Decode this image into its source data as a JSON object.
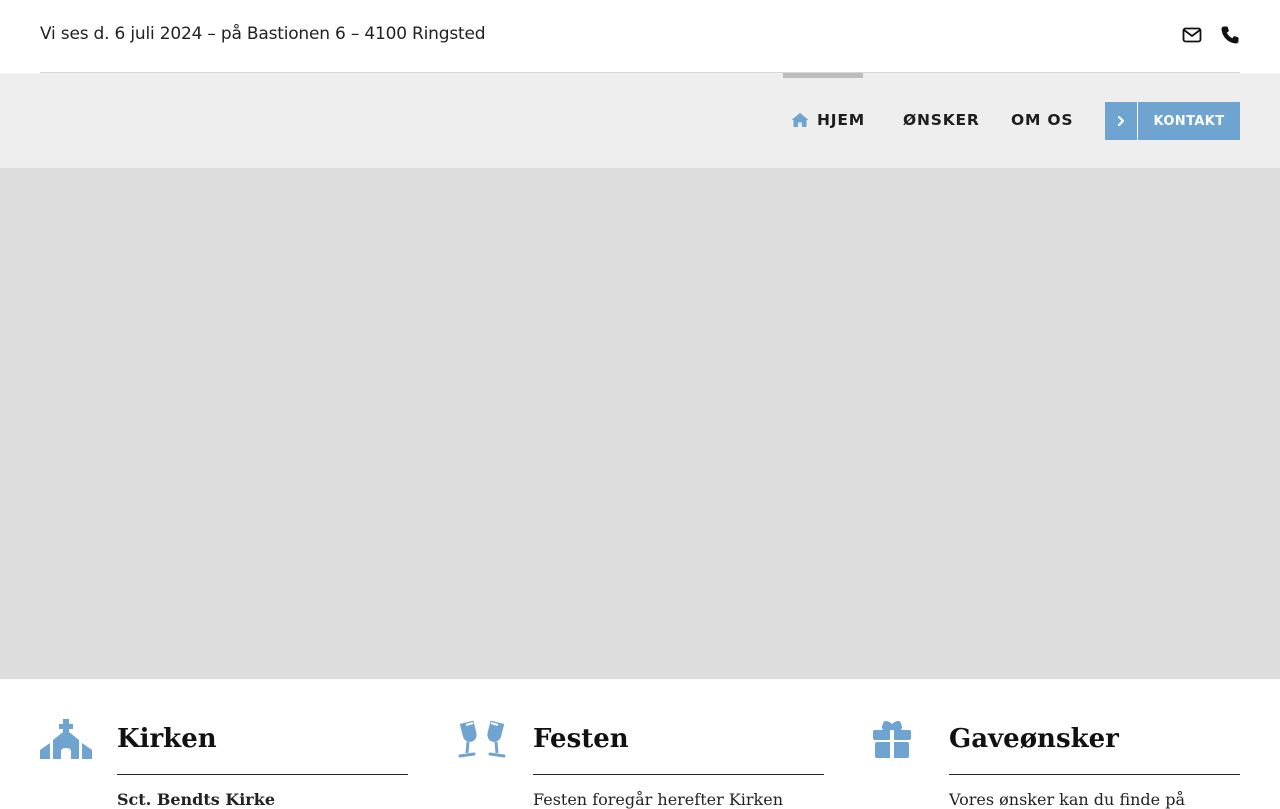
{
  "topbar": {
    "announcement": "Vi ses d. 6 juli 2024 – på Bastionen 6 – 4100 Ringsted",
    "icons": [
      "envelope-icon",
      "phone-icon"
    ]
  },
  "nav": {
    "items": [
      {
        "label": "HJEM",
        "icon": "home-icon",
        "active": true
      },
      {
        "label": "ØNSKER"
      },
      {
        "label": "OM OS"
      }
    ],
    "cta_label": "KONTAKT",
    "cta_icon": "chevron-right-icon"
  },
  "features": [
    {
      "title": "Kirken",
      "icon": "church-icon",
      "subtitle": "Sct. Bendts Kirke"
    },
    {
      "title": "Festen",
      "icon": "glasses-icon",
      "subtitle": "Festen foregår herefter Kirken"
    },
    {
      "title": "Gaveønsker",
      "icon": "gift-icon",
      "subtitle": "Vores ønsker kan du finde på"
    }
  ],
  "colors": {
    "accent": "#6ea4cf",
    "nav_bg": "#eeeeee",
    "hero_bg": "#dddddd"
  }
}
